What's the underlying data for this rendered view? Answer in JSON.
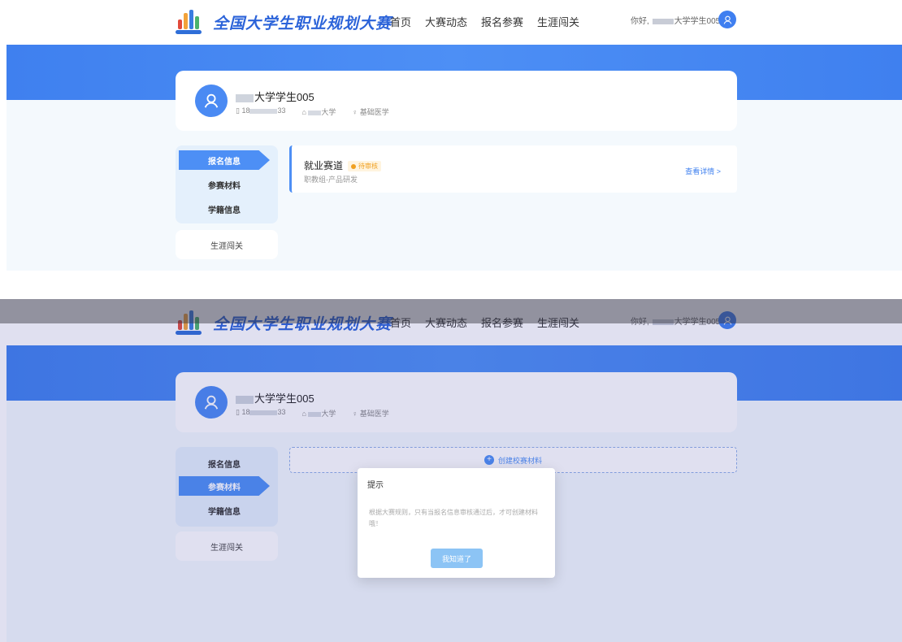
{
  "header": {
    "site_title": "全国大学生职业规划大赛",
    "nav": [
      "首页",
      "大赛动态",
      "报名参赛",
      "生涯闯关"
    ],
    "greeting": "你好,",
    "user_suffix": "大学学生005"
  },
  "profile": {
    "name_suffix": "大学学生005",
    "phone_prefix": "18",
    "phone_suffix": "33",
    "school_suffix": "大学",
    "major": "基础医学"
  },
  "menu": {
    "items": [
      "报名信息",
      "参赛材料",
      "学籍信息"
    ],
    "extra": "生涯闯关"
  },
  "entry": {
    "title": "就业赛道",
    "badge": "待审核",
    "subtitle": "职教组-产品研发",
    "detail_link": "查看详情 >"
  },
  "bottom": {
    "create_label": "创建校赛材料",
    "dialog_title": "提示",
    "dialog_body": "根据大赛规则，只有当报名信息审核通过后，才可创建材料哦！",
    "dialog_button": "我知道了"
  },
  "colors": {
    "primary": "#4d8ff5",
    "title_blue": "#2b63d9",
    "badge_orange": "#f0a020"
  }
}
